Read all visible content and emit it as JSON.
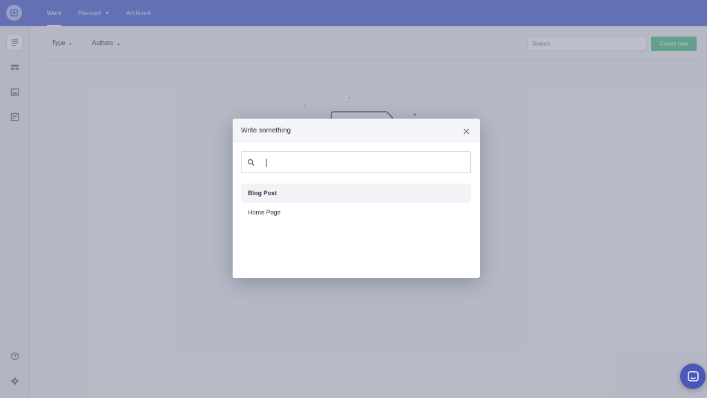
{
  "nav": {
    "tabs": [
      {
        "label": "Work"
      },
      {
        "label": "Planned"
      },
      {
        "label": "Archived"
      }
    ]
  },
  "toolbar": {
    "filter_type": "Type",
    "filter_authors": "Authors",
    "search_placeholder": "Search",
    "create_label": "Create new"
  },
  "modal": {
    "title": "Write something",
    "search_value": "",
    "options": [
      {
        "label": "Blog Post"
      },
      {
        "label": "Home Page"
      }
    ]
  },
  "icons": {
    "logo": "app-logo-icon",
    "sidebar": [
      "list-icon",
      "layout-icon",
      "image-icon",
      "edit-image-icon"
    ],
    "help": "question-icon",
    "settings": "gear-icon",
    "chat": "chat-icon"
  },
  "colors": {
    "topbar": "#7b8ae0",
    "primary_button": "#7ed1a8",
    "chat": "#4a58b8"
  }
}
